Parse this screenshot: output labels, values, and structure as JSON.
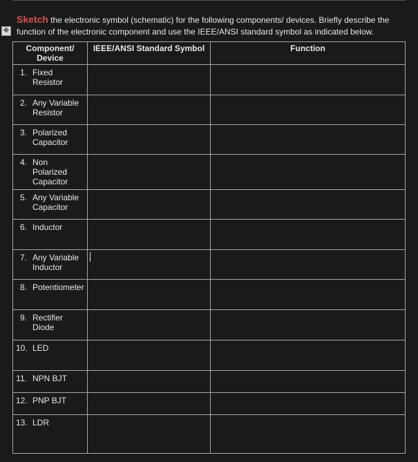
{
  "instructions": {
    "sketch_word": "Sketch",
    "rest": " the electronic symbol (schematic) for the following components/ devices. Briefly describe the function of the electronic component and use the IEEE/ANSI standard symbol as indicated below."
  },
  "headers": {
    "component": "Component/ Device",
    "symbol": "IEEE/ANSI Standard Symbol",
    "function": "Function"
  },
  "rows": [
    {
      "num": "1",
      "name": "Fixed Resistor",
      "height": "h-tall",
      "symbol": "",
      "function": ""
    },
    {
      "num": "2",
      "name": "Any Variable Resistor",
      "height": "h-med",
      "symbol": "",
      "function": ""
    },
    {
      "num": "3",
      "name": "Polarized Capacitor",
      "height": "h-med",
      "symbol": "",
      "function": ""
    },
    {
      "num": "4",
      "name": "Non Polarized Capacitor",
      "height": "h-med",
      "symbol": "",
      "function": ""
    },
    {
      "num": "5",
      "name": "Any Variable Capacitor",
      "height": "h-med",
      "symbol": "",
      "function": ""
    },
    {
      "num": "6",
      "name": "Inductor",
      "height": "h-tall",
      "symbol": "",
      "function": ""
    },
    {
      "num": "7",
      "name": "Any Variable Inductor",
      "height": "h-med",
      "symbol": "cursor",
      "function": ""
    },
    {
      "num": "8",
      "name": "Potentiometer",
      "height": "h-tall",
      "symbol": "",
      "function": ""
    },
    {
      "num": "9",
      "name": "Rectifier Diode",
      "height": "h-tall",
      "symbol": "",
      "function": ""
    },
    {
      "num": "10",
      "name": "LED",
      "height": "h-tall",
      "symbol": "",
      "function": ""
    },
    {
      "num": "11",
      "name": "NPN BJT",
      "height": "h-sm",
      "symbol": "",
      "function": ""
    },
    {
      "num": "12",
      "name": "PNP BJT",
      "height": "h-sm",
      "symbol": "",
      "function": ""
    },
    {
      "num": "13",
      "name": "LDR",
      "height": "h-lg",
      "symbol": "",
      "function": ""
    }
  ],
  "anchor_glyph": "✥"
}
